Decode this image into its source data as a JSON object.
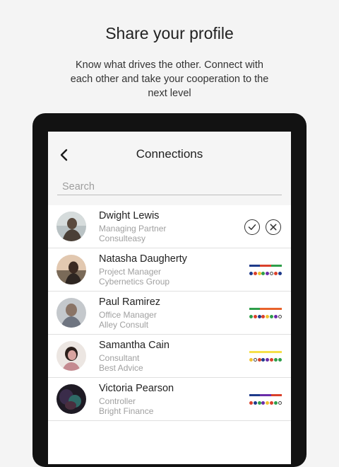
{
  "intro": {
    "title": "Share your profile",
    "description": "Know what drives the other. Connect with each other and take your cooperation to the next level"
  },
  "screen": {
    "title": "Connections",
    "back_icon": "chevron-left-icon",
    "search": {
      "placeholder": "Search",
      "value": ""
    }
  },
  "connections": [
    {
      "name": "Dwight Lewis",
      "role": "Managing Partner",
      "company": "Consulteasy",
      "status": "pending",
      "actions": {
        "accept_icon": "check-circle-icon",
        "decline_icon": "close-circle-icon"
      }
    },
    {
      "name": "Natasha Daugherty",
      "role": "Project Manager",
      "company": "Cybernetics Group",
      "status": "connected",
      "bar_colors": [
        "#1e3a8a",
        "#d9402b",
        "#2e9e4a"
      ],
      "dot_colors": [
        "#1e3a8a",
        "#d9402b",
        "#f2c230",
        "#2e9e4a",
        "#6a2ca8",
        "ring",
        "#d9402b",
        "#1e3a8a"
      ]
    },
    {
      "name": "Paul Ramirez",
      "role": "Office Manager",
      "company": "Alley Consult",
      "status": "connected",
      "bar_colors": [
        "#2e9e4a",
        "#e8622b",
        "#e8622b"
      ],
      "dot_colors": [
        "#2e9e4a",
        "#d9402b",
        "#1e3a8a",
        "#d9402b",
        "#f2c230",
        "#2e9e4a",
        "#6a2ca8",
        "ring"
      ]
    },
    {
      "name": "Samantha Cain",
      "role": "Consultant",
      "company": "Best Advice",
      "status": "connected",
      "bar_colors": [
        "#f5e04a",
        "#f5e04a",
        "#f5e04a"
      ],
      "dot_colors": [
        "#f2c230",
        "ring",
        "#d9402b",
        "#1e3a8a",
        "#6a2ca8",
        "#d9402b",
        "#2e9e4a",
        "#2e9e4a"
      ]
    },
    {
      "name": "Victoria Pearson",
      "role": "Controller",
      "company": "Bright Finance",
      "status": "connected",
      "bar_colors": [
        "#1e3a8a",
        "#6a2ca8",
        "#d9402b"
      ],
      "dot_colors": [
        "#d9402b",
        "#1e3a8a",
        "#2e9e4a",
        "#6a2ca8",
        "#f2c230",
        "#d9402b",
        "#2e9e4a",
        "ring"
      ]
    }
  ]
}
